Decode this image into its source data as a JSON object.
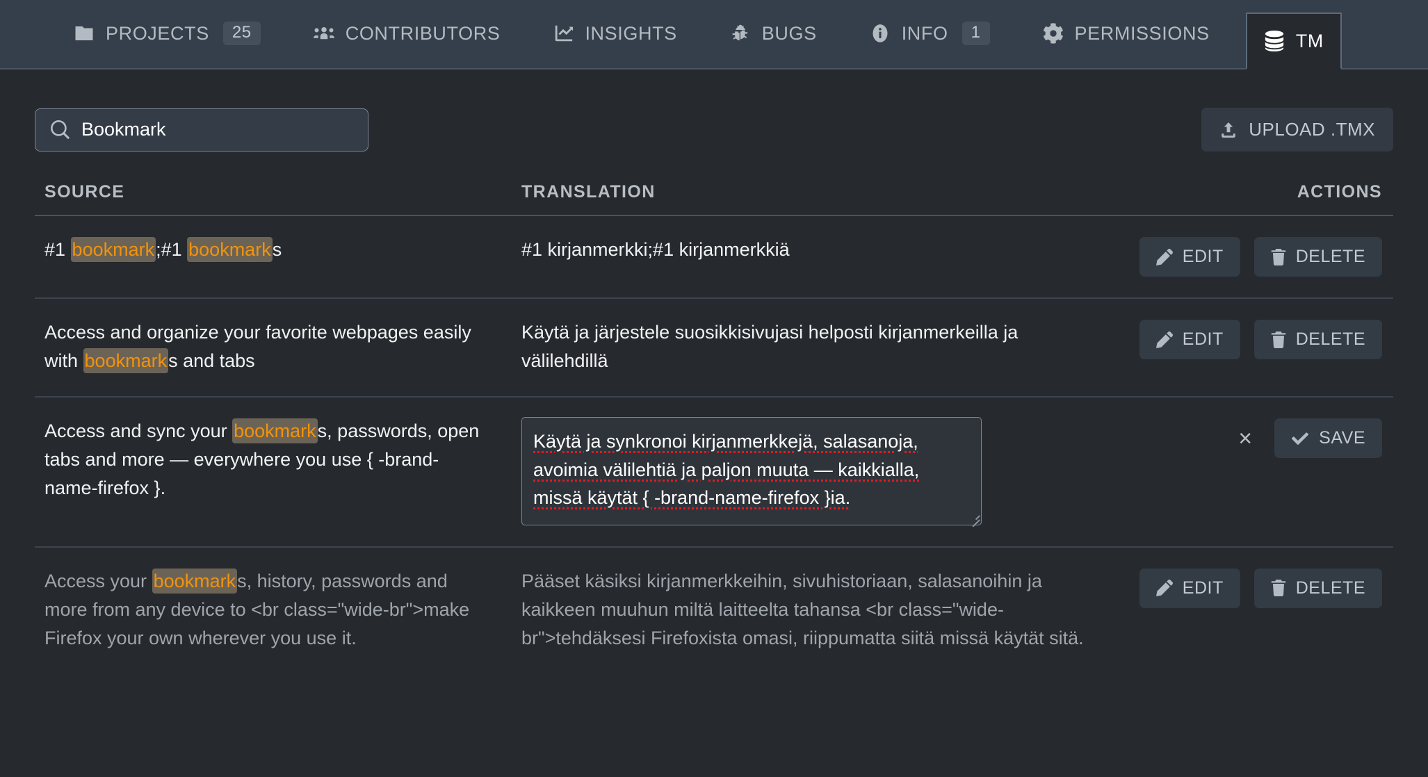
{
  "nav": {
    "items": [
      {
        "id": "projects",
        "label": "PROJECTS",
        "icon": "folder-icon",
        "badge": "25"
      },
      {
        "id": "contributors",
        "label": "CONTRIBUTORS",
        "icon": "people-icon",
        "badge": null
      },
      {
        "id": "insights",
        "label": "INSIGHTS",
        "icon": "chart-line-icon",
        "badge": null
      },
      {
        "id": "bugs",
        "label": "BUGS",
        "icon": "bug-icon",
        "badge": null
      },
      {
        "id": "info",
        "label": "INFO",
        "icon": "info-circle-icon",
        "badge": "1"
      },
      {
        "id": "permissions",
        "label": "PERMISSIONS",
        "icon": "gear-icon",
        "badge": null
      },
      {
        "id": "tm",
        "label": "TM",
        "icon": "database-icon",
        "badge": null,
        "active": true
      }
    ]
  },
  "toolbar": {
    "search": {
      "value": "Bookmark",
      "placeholder": "Search",
      "icon": "search-icon"
    },
    "upload": {
      "label": "UPLOAD .TMX",
      "icon": "upload-icon"
    }
  },
  "table": {
    "headers": {
      "source": "SOURCE",
      "translation": "TRANSLATION",
      "actions": "ACTIONS"
    },
    "actions": {
      "edit": "EDIT",
      "delete": "DELETE",
      "save": "SAVE",
      "cancel": "×"
    },
    "rows": [
      {
        "id": "row-1",
        "state": "normal",
        "source_parts": [
          {
            "t": "#1 ",
            "hl": false
          },
          {
            "t": "bookmark",
            "hl": true
          },
          {
            "t": ";#1 ",
            "hl": false
          },
          {
            "t": "bookmark",
            "hl": true
          },
          {
            "t": "s",
            "hl": false
          }
        ],
        "translation": "#1 kirjanmerkki;#1 kirjanmerkkiä"
      },
      {
        "id": "row-2",
        "state": "normal",
        "source_parts": [
          {
            "t": "Access and organize your favorite webpages easily with ",
            "hl": false
          },
          {
            "t": "bookmark",
            "hl": true
          },
          {
            "t": "s and tabs",
            "hl": false
          }
        ],
        "translation": "Käytä ja järjestele suosikkisivujasi helposti kirjanmerkeilla ja välilehdillä"
      },
      {
        "id": "row-3",
        "state": "editing",
        "source_parts": [
          {
            "t": "Access and sync your ",
            "hl": false
          },
          {
            "t": "bookmark",
            "hl": true
          },
          {
            "t": "s, passwords, open tabs and more — everywhere you use { -brand-name-firefox }.",
            "hl": false
          }
        ],
        "translation": "Käytä ja synkronoi kirjanmerkkejä, salasanoja, avoimia välilehtiä ja paljon muuta — kaikkialla, missä käytät { -brand-name-firefox }ia."
      },
      {
        "id": "row-4",
        "state": "dim",
        "source_parts": [
          {
            "t": "Access your ",
            "hl": false
          },
          {
            "t": "bookmark",
            "hl": true
          },
          {
            "t": "s, history, passwords and more from any device to <br class=\"wide-br\">make Firefox your own wherever you use it.",
            "hl": false
          }
        ],
        "translation": "Pääset käsiksi kirjanmerkkeihin, sivuhistoriaan, salasanoihin ja kaikkeen muuhun miltä laitteelta tahansa <br class=\"wide-br\">tehdäksesi Firefoxista omasi, riippumatta siitä missä käytät sitä."
      }
    ]
  },
  "colors": {
    "nav_bg": "#353f4b",
    "content_bg": "#26292d",
    "highlight_bg": "#6c6357",
    "highlight_fg": "#f0930d",
    "button_bg": "#333b45",
    "text": "#f1f2f3",
    "muted_text": "#9fa5ac",
    "spellcheck": "#e01b24"
  }
}
